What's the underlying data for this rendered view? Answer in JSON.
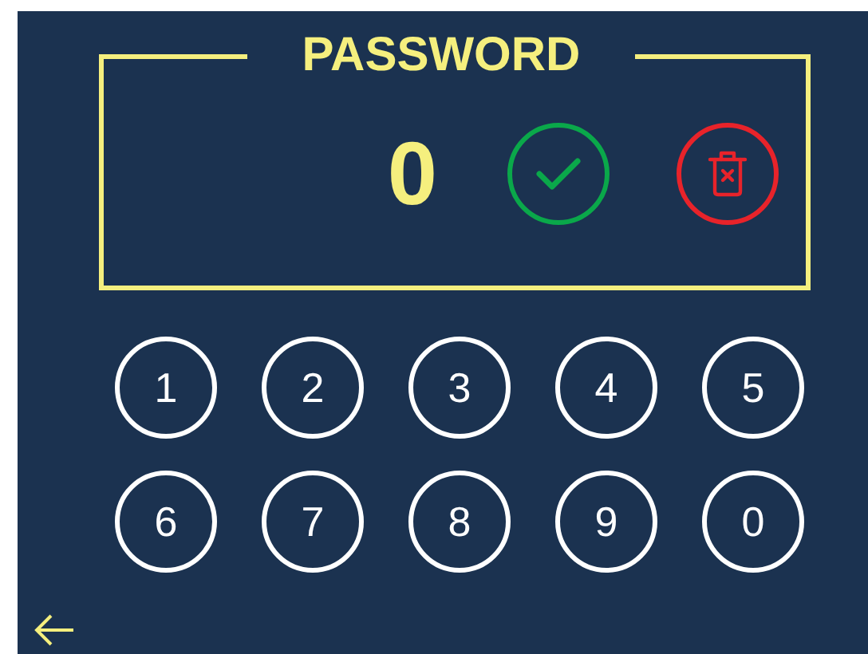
{
  "title": "PASSWORD",
  "display": {
    "value": "0"
  },
  "keys": [
    "1",
    "2",
    "3",
    "4",
    "5",
    "6",
    "7",
    "8",
    "9",
    "0"
  ]
}
